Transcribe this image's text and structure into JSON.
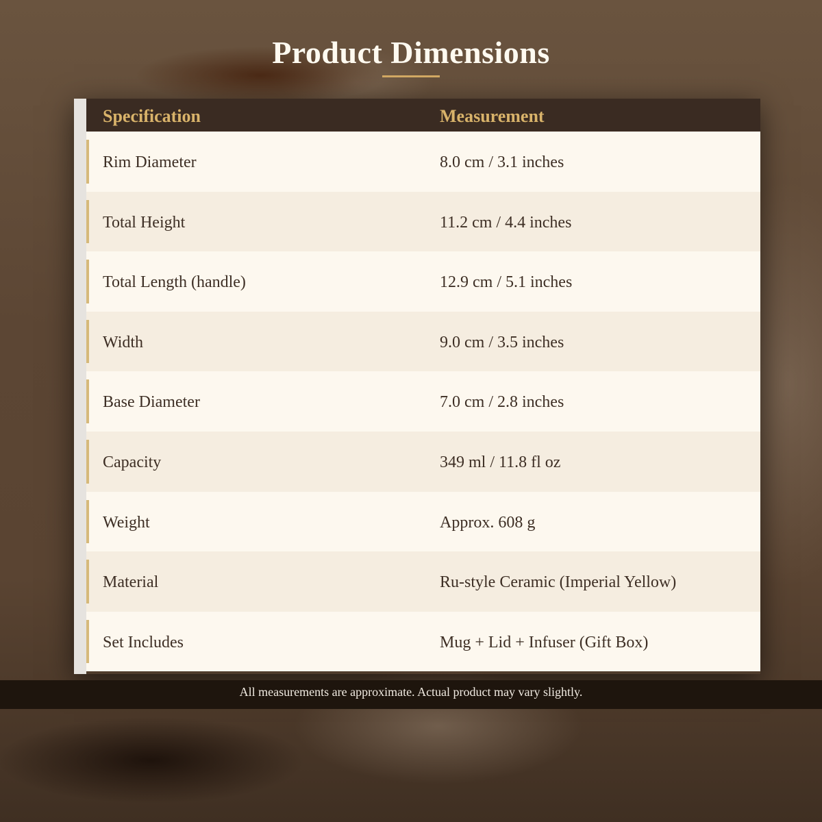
{
  "page": {
    "title": "Product Dimensions",
    "accent_color": "#d4aa64"
  },
  "table": {
    "headers": {
      "specification": "Specification",
      "measurement": "Measurement"
    },
    "rows": [
      {
        "spec": "Rim Diameter",
        "value": "8.0 cm / 3.1 inches"
      },
      {
        "spec": "Total Height",
        "value": "11.2 cm / 4.4 inches"
      },
      {
        "spec": "Total Length (handle)",
        "value": "12.9 cm / 5.1 inches"
      },
      {
        "spec": "Width",
        "value": "9.0 cm / 3.5 inches"
      },
      {
        "spec": "Base Diameter",
        "value": "7.0 cm / 2.8 inches"
      },
      {
        "spec": "Capacity",
        "value": "349 ml / 11.8 fl oz"
      },
      {
        "spec": "Weight",
        "value": "Approx. 608 g"
      },
      {
        "spec": "Material",
        "value": "Ru-style Ceramic (Imperial Yellow)"
      },
      {
        "spec": "Set Includes",
        "value": "Mug + Lid + Infuser (Gift Box)"
      }
    ]
  },
  "footer": {
    "note": "All measurements are approximate. Actual product may vary slightly."
  }
}
